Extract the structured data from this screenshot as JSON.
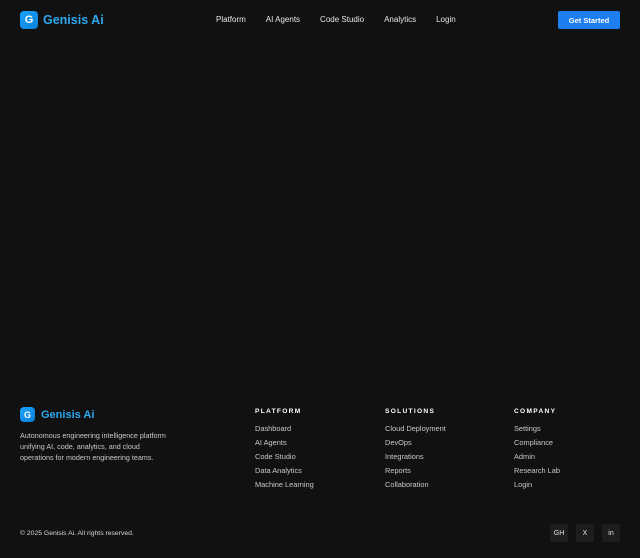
{
  "brand": {
    "mark": "G",
    "name": "Genisis Ai",
    "accent": "#2ea8f0"
  },
  "nav": {
    "items": [
      "Platform",
      "AI Agents",
      "Code Studio",
      "Analytics",
      "Login"
    ],
    "cta_label": "Get Started",
    "cta_color": "#1d7ef0"
  },
  "footer": {
    "tagline": "Autonomous engineering intelligence platform unifying AI, code, analytics, and cloud operations for modern engineering teams.",
    "columns": [
      {
        "title": "PLATFORM",
        "links": [
          "Dashboard",
          "AI Agents",
          "Code Studio",
          "Data Analytics",
          "Machine Learning"
        ]
      },
      {
        "title": "SOLUTIONS",
        "links": [
          "Cloud Deployment",
          "DevOps",
          "Integrations",
          "Reports",
          "Collaboration"
        ]
      },
      {
        "title": "COMPANY",
        "links": [
          "Settings",
          "Compliance",
          "Admin",
          "Research Lab",
          "Login"
        ]
      }
    ],
    "copyright": "© 2025 Genisis Ai. All rights reserved.",
    "socials": [
      "GH",
      "X",
      "in"
    ]
  }
}
